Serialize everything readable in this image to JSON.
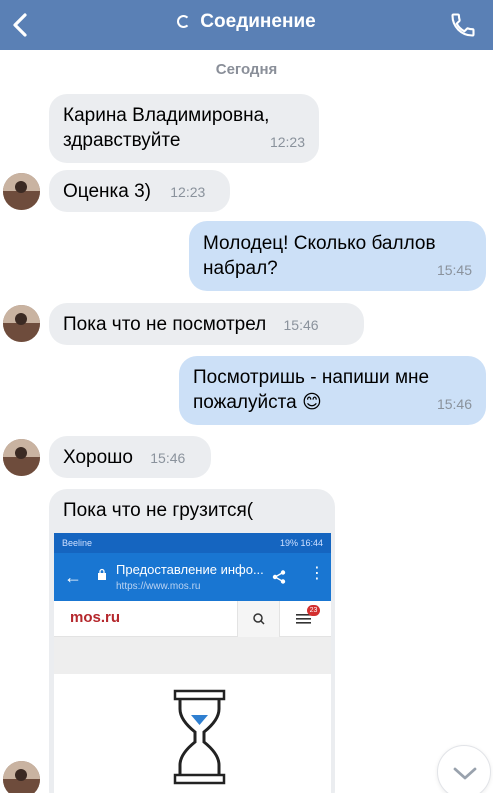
{
  "header": {
    "title": "Соединение",
    "back_icon": "chevron-left-icon",
    "call_icon": "phone-icon",
    "status_icon": "spinner-icon"
  },
  "date_separator": "Сегодня",
  "messages": [
    {
      "line1": "Карина Владимировна,",
      "line2": "здравствуйте",
      "time": "12:23"
    },
    {
      "text": "Оценка 3)",
      "time": "12:23"
    },
    {
      "line1": "Молодец! Сколько баллов",
      "line2": "набрал?",
      "time": "15:45"
    },
    {
      "text": "Пока что не посмотрел",
      "time": "15:46"
    },
    {
      "line1": "Посмотришь - напиши мне",
      "line2": "пожалуйста",
      "emoji": "😊",
      "time": "15:46"
    },
    {
      "text": "Хорошо",
      "time": "15:46"
    },
    {
      "text": "Пока что не грузится("
    }
  ],
  "screenshot": {
    "carrier": "Beeline",
    "status_right": "19% 16:44",
    "page_title": "Предоставление инфо...",
    "url": "https://www.mos.ru",
    "site_logo": "mos.ru",
    "badge_count": "23"
  },
  "colors": {
    "header": "#5a80b5",
    "outgoing_bubble": "#cce0f7",
    "incoming_bubble": "#ebedf0",
    "browser_bar": "#1976d2",
    "hourglass_sand": "#2f7fd0"
  }
}
